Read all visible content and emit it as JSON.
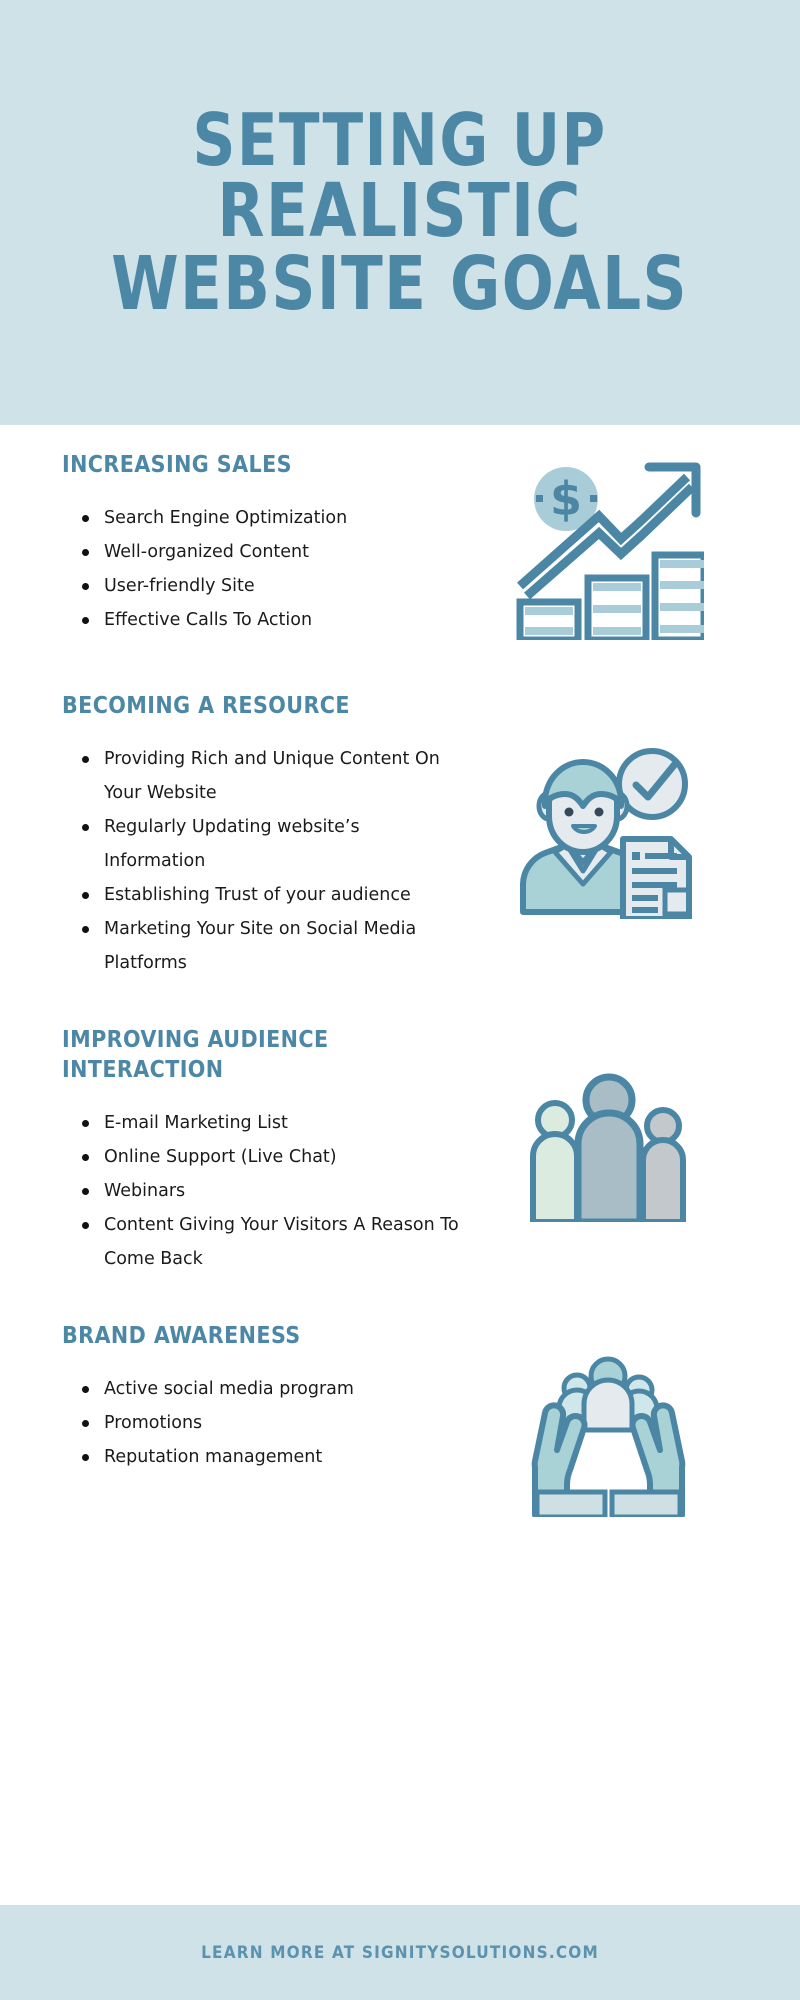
{
  "header": {
    "title_line1": "SETTING UP",
    "title_line2": "REALISTIC",
    "title_line3": "WEBSITE GOALS",
    "band_color": "#cfe2e8",
    "title_color": "#4c87a6"
  },
  "sections": [
    {
      "heading": "INCREASING SALES",
      "icon": "sales-growth-chart-icon",
      "bullets": [
        "Search Engine Optimization",
        "Well-organized Content",
        "User-friendly Site",
        "Effective Calls To Action"
      ]
    },
    {
      "heading": "BECOMING A RESOURCE",
      "icon": "support-agent-document-icon",
      "bullets": [
        "Providing Rich and Unique Content On Your Website",
        "Regularly Updating website’s Information",
        "Establishing Trust of your audience",
        "Marketing Your Site on Social Media Platforms"
      ]
    },
    {
      "heading": "IMPROVING AUDIENCE INTERACTION",
      "icon": "three-people-group-icon",
      "bullets": [
        "E-mail Marketing List",
        "Online Support (Live Chat)",
        "Webinars",
        "Content Giving Your Visitors A Reason To Come Back"
      ]
    },
    {
      "heading": "BRAND AWARENESS",
      "icon": "hands-holding-people-icon",
      "bullets": [
        "Active social media program",
        "Promotions",
        "Reputation management"
      ]
    }
  ],
  "footer": {
    "text": "LEARN MORE AT SIGNITYSOLUTIONS.COM",
    "band_color": "#cfe2e8",
    "text_color": "#5b92ad"
  },
  "palette": {
    "accent_blue": "#4c87a6",
    "stroke_blue": "#4b87a4",
    "pale_blue": "#a9cdd8",
    "light_blue_fill": "#b9d6de",
    "mint": "#dcebe0",
    "gray": "#c2c8cc",
    "blue_gray": "#a9bdc7",
    "near_white": "#e4eaee",
    "body_text": "#1b1b1b"
  }
}
